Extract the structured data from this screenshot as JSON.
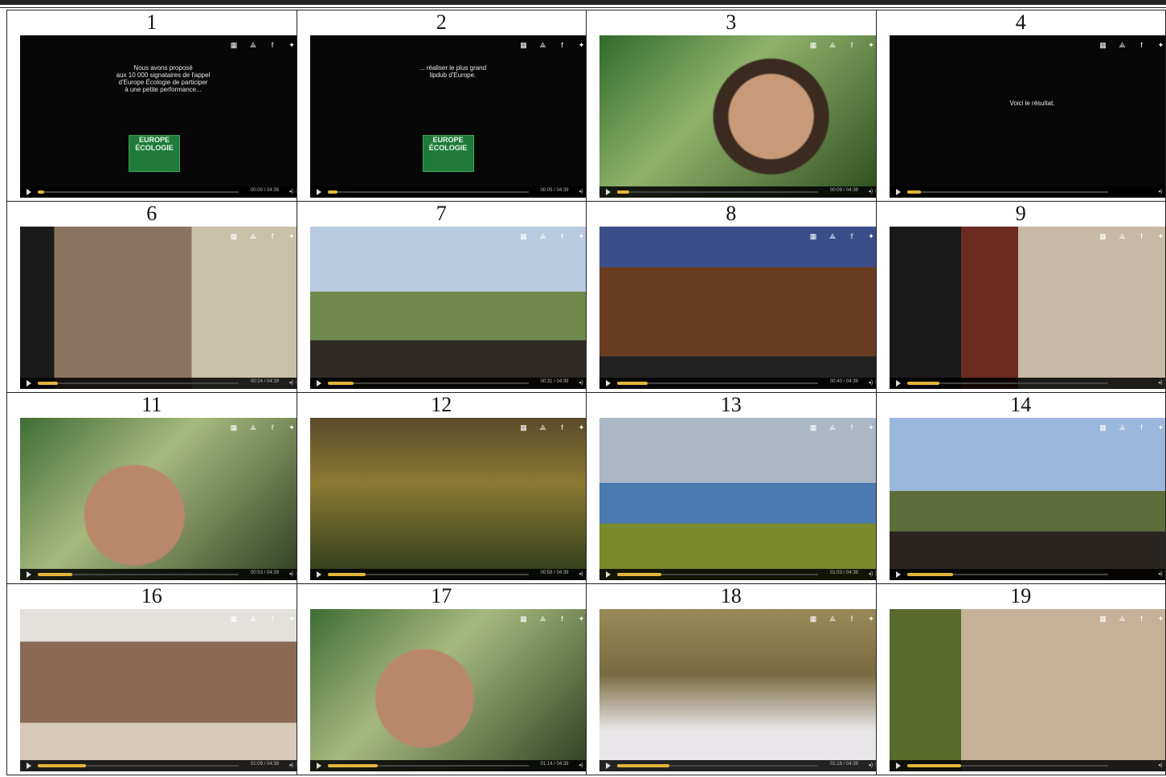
{
  "grid": {
    "rows": [
      [
        {
          "label": "1",
          "type": "text",
          "lines": "Nous avons proposé\naux 10 000 signataires de l'appel\nd'Europe Écologie de participer\nà une petite performance...",
          "logo": [
            "EUROPE",
            "ÉCOLOGIE"
          ],
          "time": "00:00 / 04:39",
          "progress": 0.02
        },
        {
          "label": "2",
          "type": "text",
          "lines": "... réaliser le plus grand\nlipdub d'Europe.",
          "logo": [
            "EUROPE",
            "ÉCOLOGIE"
          ],
          "time": "00:05 / 04:39",
          "progress": 0.05
        },
        {
          "label": "3",
          "type": "video",
          "time": "00:09 / 04:39",
          "progress": 0.06
        },
        {
          "label": "4",
          "type": "text",
          "lines": "Voici le résultat.",
          "time": "",
          "progress": 0.07
        }
      ],
      [
        {
          "label": "6",
          "type": "video",
          "time": "00:24 / 04:39",
          "progress": 0.1
        },
        {
          "label": "7",
          "type": "video",
          "time": "00:31 / 04:39",
          "progress": 0.13
        },
        {
          "label": "8",
          "type": "video",
          "time": "00:40 / 04:39",
          "progress": 0.15
        },
        {
          "label": "9",
          "type": "video",
          "time": "",
          "progress": 0.16
        }
      ],
      [
        {
          "label": "11",
          "type": "video",
          "time": "00:53 / 04:39",
          "progress": 0.17
        },
        {
          "label": "12",
          "type": "video",
          "time": "00:58 / 04:39",
          "progress": 0.19
        },
        {
          "label": "13",
          "type": "video",
          "time": "01:03 / 04:39",
          "progress": 0.22
        },
        {
          "label": "14",
          "type": "video",
          "time": "",
          "progress": 0.23
        }
      ],
      [
        {
          "label": "16",
          "type": "video",
          "time": "01:09 / 04:39",
          "progress": 0.24
        },
        {
          "label": "17",
          "type": "video",
          "time": "01:14 / 04:39",
          "progress": 0.25
        },
        {
          "label": "18",
          "type": "video",
          "time": "01:18 / 04:39",
          "progress": 0.26
        },
        {
          "label": "19",
          "type": "video",
          "time": "",
          "progress": 0.27
        }
      ]
    ]
  }
}
